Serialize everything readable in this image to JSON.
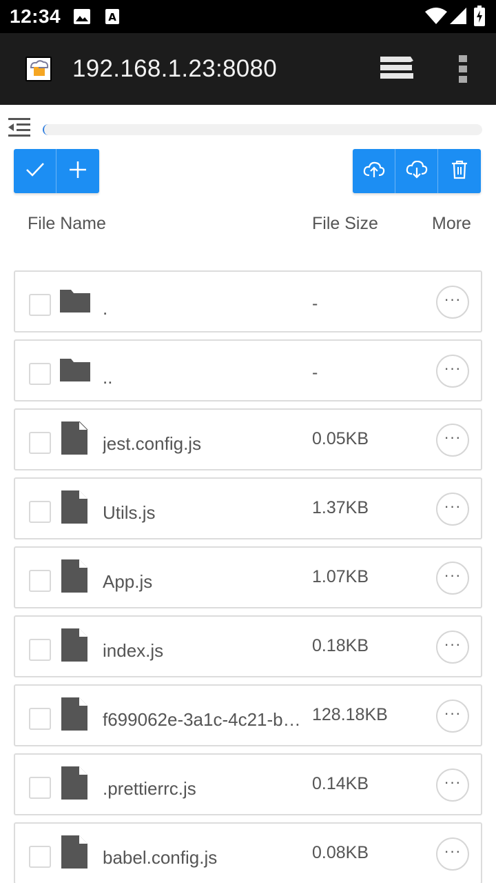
{
  "status_bar": {
    "time": "12:34",
    "icons": [
      "image-icon",
      "a-text-icon",
      "wifi-icon",
      "signal-icon",
      "battery-icon"
    ]
  },
  "app_bar": {
    "logo_icon": "app-cloud-folder-icon",
    "url": "192.168.1.23:8080",
    "actions": [
      "layers-icon",
      "more-vert-icon"
    ]
  },
  "path_bar": {
    "collapse_icon": "collapse-menu-icon",
    "path_value": ""
  },
  "toolbar": {
    "left": [
      "check-icon",
      "plus-icon"
    ],
    "right": [
      "cloud-upload-icon",
      "cloud-download-icon",
      "trash-icon"
    ],
    "accent": "#1c8ef3"
  },
  "columns": {
    "name": "File Name",
    "size": "File Size",
    "more": "More"
  },
  "files": [
    {
      "type": "folder",
      "name": ".",
      "size": "-"
    },
    {
      "type": "folder",
      "name": "..",
      "size": "-"
    },
    {
      "type": "file",
      "name": "jest.config.js",
      "size": "0.05KB"
    },
    {
      "type": "file",
      "name": "Utils.js",
      "size": "1.37KB"
    },
    {
      "type": "file",
      "name": "App.js",
      "size": "1.07KB"
    },
    {
      "type": "file",
      "name": "index.js",
      "size": "0.18KB"
    },
    {
      "type": "file",
      "name": "f699062e-3a1c-4c21-b…",
      "size": "128.18KB"
    },
    {
      "type": "file",
      "name": ".prettierrc.js",
      "size": "0.14KB"
    },
    {
      "type": "file",
      "name": "babel.config.js",
      "size": "0.08KB"
    }
  ],
  "more_glyph": "···"
}
